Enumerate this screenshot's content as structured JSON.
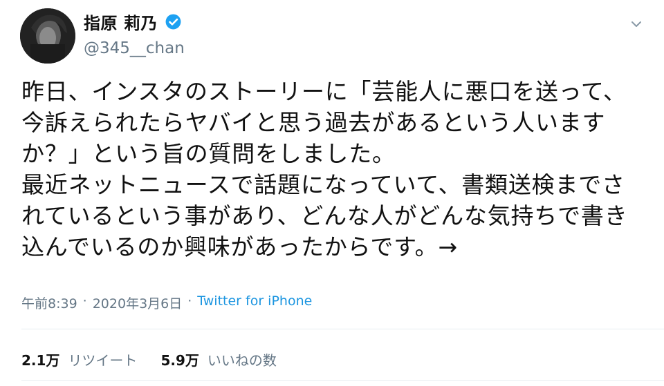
{
  "author": {
    "display_name": "指原 莉乃",
    "handle": "@345__chan",
    "verified_badge_icon": "verified-badge-icon",
    "avatar_icon": "avatar-photo"
  },
  "tweet": {
    "text": "昨日、インスタのストーリーに「芸能人に悪口を送って、今訴えられたらヤバイと思う過去があるという人いますか？」という旨の質問をしました。\n最近ネットニュースで話題になっていて、書類送検までされているという事があり、どんな人がどんな気持ちで書き込んでいるのか興味があったからです。→",
    "time": "午前8:39",
    "date": "2020年3月6日",
    "separator_1": "·",
    "separator_2": "·",
    "source": "Twitter for iPhone"
  },
  "stats": {
    "retweets_count": "2.1万",
    "retweets_label": "リツイート",
    "likes_count": "5.9万",
    "likes_label": "いいねの数"
  },
  "icons": {
    "menu": "chevron-down-icon"
  },
  "colors": {
    "text": "#111111",
    "secondary": "#657786",
    "link": "#1b95e0",
    "verified": "#1da1f2",
    "divider": "#e6ecf0"
  }
}
